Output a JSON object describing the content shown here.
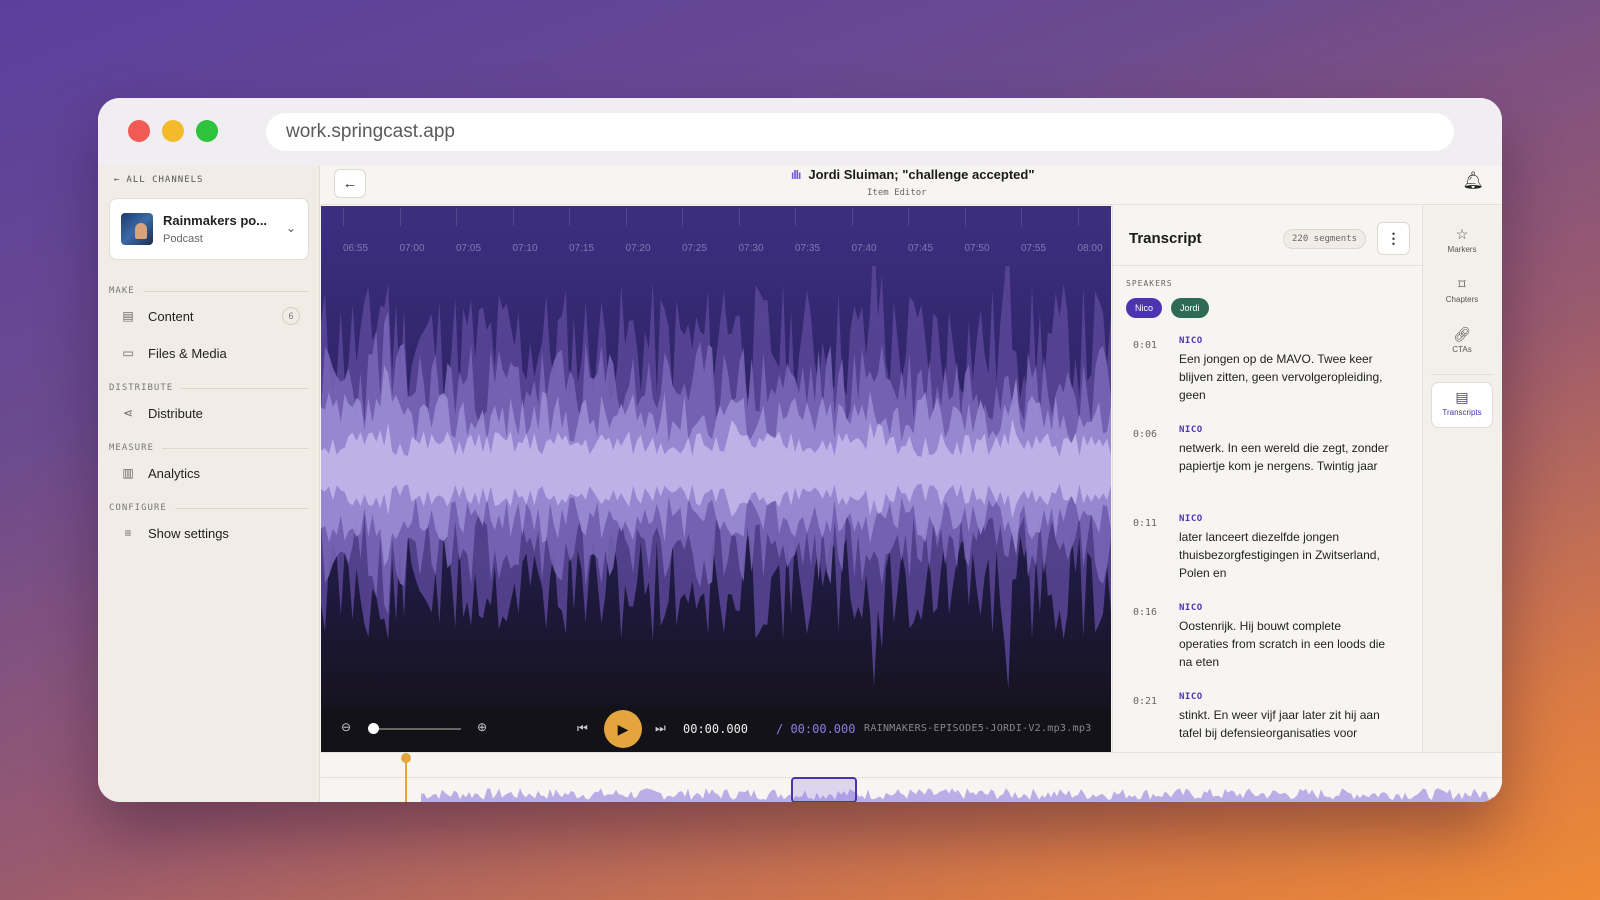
{
  "browser": {
    "url": "work.springcast.app"
  },
  "sidebar": {
    "back_label": "ALL CHANNELS",
    "channel": {
      "name": "Rainmakers po...",
      "type": "Podcast"
    },
    "sections": {
      "make": "MAKE",
      "distribute": "DISTRIBUTE",
      "measure": "MEASURE",
      "configure": "CONFIGURE"
    },
    "items": {
      "content": {
        "label": "Content",
        "badge": "6",
        "icon": "document-icon"
      },
      "files": {
        "label": "Files & Media",
        "icon": "folder-icon"
      },
      "distribute": {
        "label": "Distribute",
        "icon": "share-icon"
      },
      "analytics": {
        "label": "Analytics",
        "icon": "chart-icon"
      },
      "settings": {
        "label": "Show settings",
        "icon": "sliders-icon"
      }
    }
  },
  "header": {
    "title": "Jordi Sluiman; \"challenge accepted\"",
    "subtitle": "Item Editor"
  },
  "timeline": {
    "ticks": [
      "06:55",
      "07:00",
      "07:05",
      "07:10",
      "07:15",
      "07:20",
      "07:25",
      "07:30",
      "07:35",
      "07:40",
      "07:45",
      "07:50",
      "07:55",
      "08:00"
    ]
  },
  "player": {
    "current_time": "00:00.000",
    "total_time": "/ 00:00.000",
    "file_name": "RAINMAKERS-EPISODE5-JORDI-V2.mp3.mp3",
    "zoom_level": 0.0
  },
  "transcript": {
    "title": "Transcript",
    "segment_count": "220 segments",
    "speakers_label": "SPEAKERS",
    "speakers": [
      "Nico",
      "Jordi"
    ],
    "segments": [
      {
        "time": "0:01",
        "speaker": "NICO",
        "text": "Een jongen op de MAVO. Twee keer blijven zitten, geen vervolgeropleiding, geen"
      },
      {
        "time": "0:06",
        "speaker": "NICO",
        "text": "netwerk. In een wereld die zegt, zonder papiertje kom je nergens. Twintig jaar"
      },
      {
        "time": "0:11",
        "speaker": "NICO",
        "text": "later lanceert diezelfde jongen thuisbezorgfestigingen in Zwitserland, Polen en"
      },
      {
        "time": "0:16",
        "speaker": "NICO",
        "text": "Oostenrijk. Hij bouwt complete operaties from scratch in een loods die na eten"
      },
      {
        "time": "0:21",
        "speaker": "NICO",
        "text": "stinkt. En weer vijf jaar later zit hij aan tafel bij defensieorganisaties voor"
      }
    ]
  },
  "rail": {
    "markers": "Markers",
    "chapters": "Chapters",
    "ctas": "CTAs",
    "transcripts": "Transcripts"
  },
  "colors": {
    "accent": "#4b34b0",
    "play": "#e5a53e",
    "jordi": "#2f6a57"
  }
}
